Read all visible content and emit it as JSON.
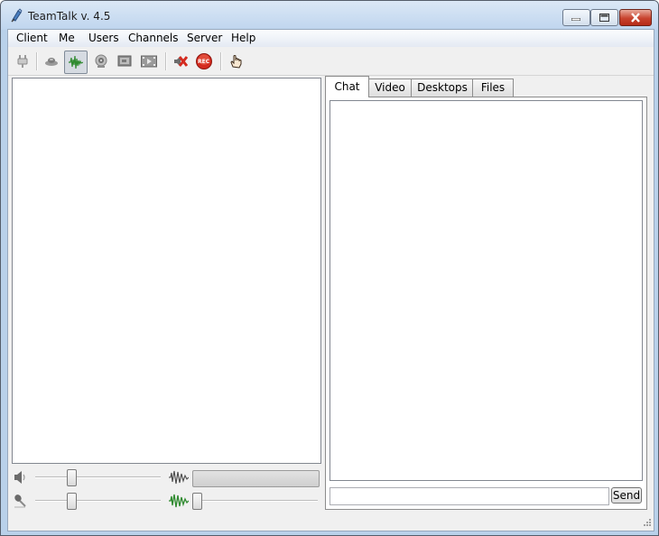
{
  "window": {
    "title": "TeamTalk v. 4.5"
  },
  "menu": [
    "Client",
    "Me",
    "Users",
    "Channels",
    "Server",
    "Help"
  ],
  "toolbar": {
    "buttons": [
      {
        "name": "connect-icon",
        "active": false
      },
      {
        "name": "stream-media-icon",
        "active": false
      },
      {
        "name": "voice-transmit-icon",
        "active": true
      },
      {
        "name": "webcam-icon",
        "active": false
      },
      {
        "name": "desktop-share-icon",
        "active": false
      },
      {
        "name": "video-file-icon",
        "active": false
      },
      {
        "name": "mute-all-icon",
        "active": false
      },
      {
        "name": "record-icon",
        "active": false
      },
      {
        "name": "hand-icon",
        "active": false
      }
    ],
    "record_badge": "REC"
  },
  "tabs": [
    "Chat",
    "Video",
    "Desktops",
    "Files"
  ],
  "active_tab": "Chat",
  "chat": {
    "input_value": "",
    "send_label": "Send"
  },
  "audio": {
    "master_volume": 0.27,
    "mic_gain": 0.27,
    "voice_activation": 0.0
  },
  "colors": {
    "accent_green": "#2f8a2f",
    "record_red": "#d42b1f"
  }
}
